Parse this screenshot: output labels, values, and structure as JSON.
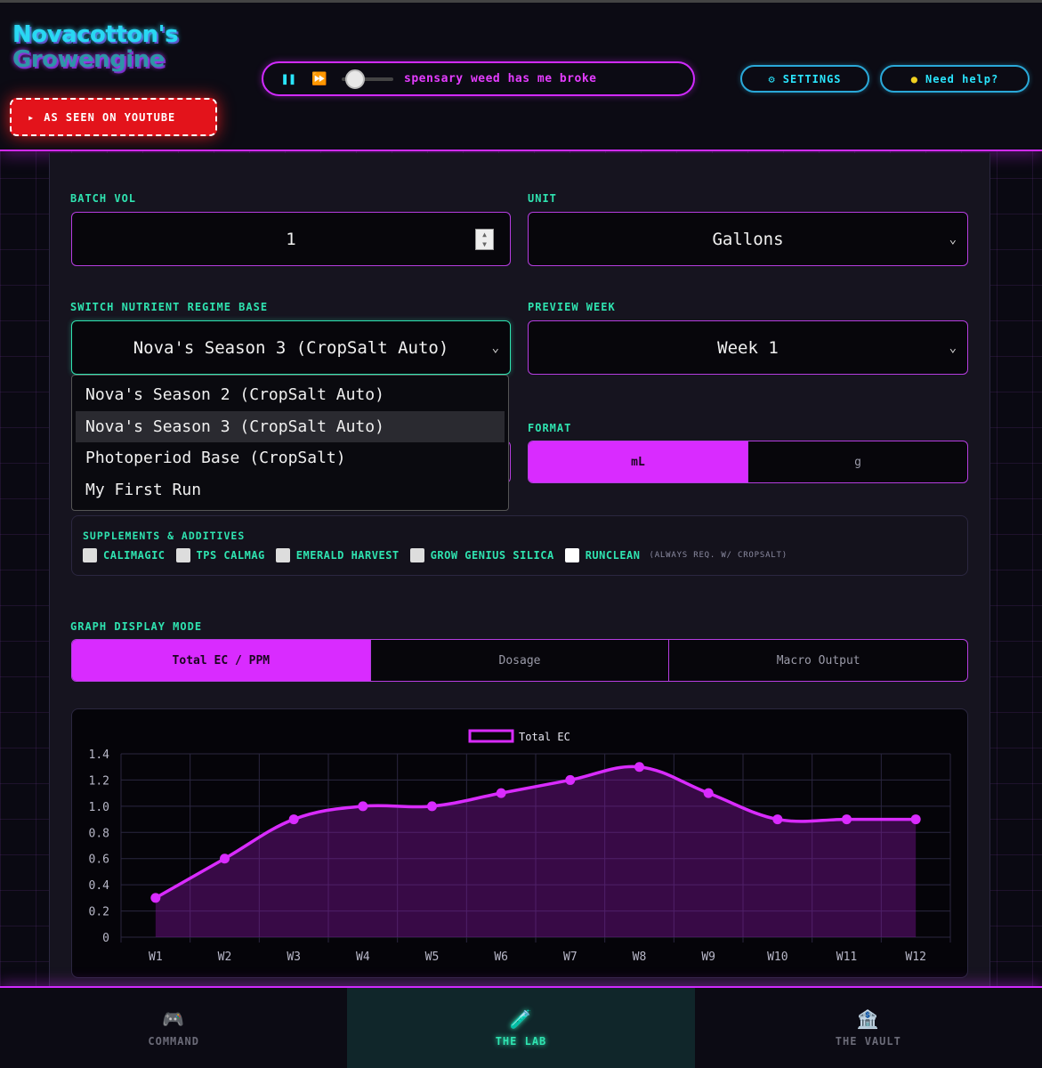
{
  "header": {
    "logo_line1": "Novacotton's",
    "logo_line2": "Growengine",
    "youtube_label": "AS SEEN ON YOUTUBE",
    "player_ticker": "spensary weed has me broke",
    "settings_label": "SETTINGS",
    "help_label": "Need help?"
  },
  "form": {
    "batch_vol_label": "BATCH VOL",
    "batch_vol_value": "1",
    "unit_label": "UNIT",
    "unit_value": "Gallons",
    "regime_label": "SWITCH NUTRIENT REGIME BASE",
    "regime_value": "Nova's Season 3 (CropSalt Auto)",
    "regime_options": [
      "Nova's Season 2 (CropSalt Auto)",
      "Nova's Season 3 (CropSalt Auto)",
      "Photoperiod Base (CropSalt)",
      "My First Run"
    ],
    "week_label": "PREVIEW WEEK",
    "week_value": "Week 1",
    "format_label": "FORMAT",
    "format_options": [
      "mL",
      "g"
    ]
  },
  "supplements": {
    "title": "SUPPLEMENTS & ADDITIVES",
    "items": [
      "CALIMAGIC",
      "TPS CALMAG",
      "EMERALD HARVEST",
      "GROW GENIUS SILICA",
      "RUNCLEAN"
    ],
    "runclean_note": "(ALWAYS REQ. W/ CROPSALT)"
  },
  "graph_mode": {
    "label": "GRAPH DISPLAY MODE",
    "options": [
      "Total EC / PPM",
      "Dosage",
      "Macro Output"
    ]
  },
  "chart_data": {
    "type": "area",
    "categories": [
      "W1",
      "W2",
      "W3",
      "W4",
      "W5",
      "W6",
      "W7",
      "W8",
      "W9",
      "W10",
      "W11",
      "W12"
    ],
    "series": [
      {
        "name": "Total EC",
        "values": [
          0.3,
          0.6,
          0.9,
          1.0,
          1.0,
          1.1,
          1.2,
          1.3,
          1.1,
          0.9,
          0.9,
          0.9
        ]
      }
    ],
    "ylim": [
      0,
      1.4
    ],
    "yticks": [
      "0",
      "0.2",
      "0.4",
      "0.6",
      "0.8",
      "1.0",
      "1.2",
      "1.4"
    ],
    "legend": "top-center",
    "color": "#d92bff"
  },
  "nav": {
    "tabs": [
      {
        "label": "COMMAND",
        "icon": "gamepad-icon"
      },
      {
        "label": "THE LAB",
        "icon": "test-tube-icon"
      },
      {
        "label": "THE VAULT",
        "icon": "bank-icon"
      }
    ]
  }
}
